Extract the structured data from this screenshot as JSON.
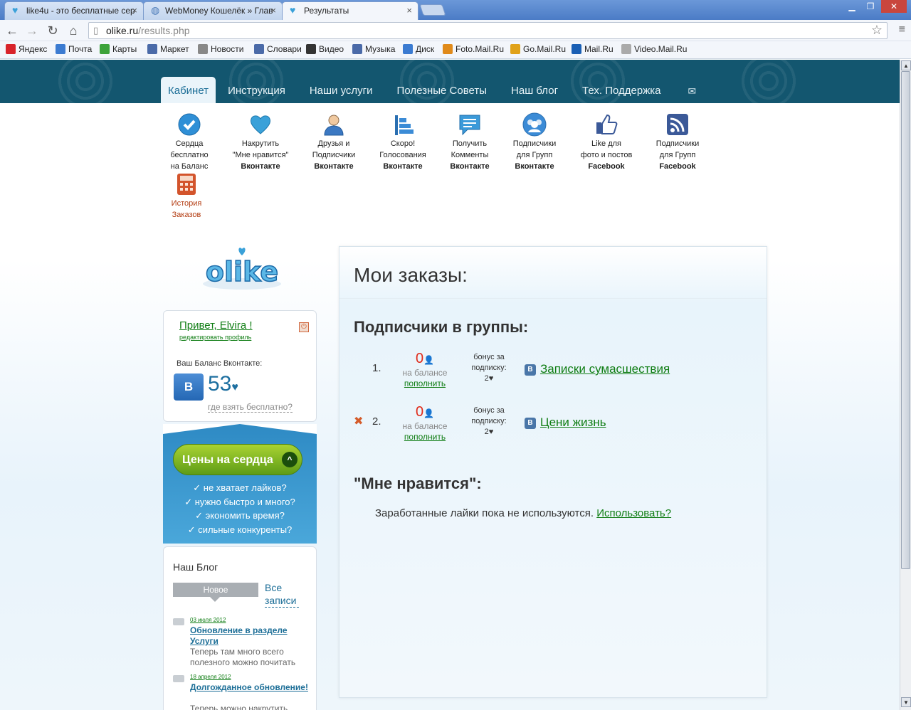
{
  "browser": {
    "tabs": [
      {
        "label": "like4u - это бесплатные сер"
      },
      {
        "label": "WebMoney Кошелёк » Глав"
      },
      {
        "label": "Результаты"
      }
    ],
    "url_host": "olike.ru",
    "url_path": "/results.php",
    "bookmarks": [
      {
        "label": "Яндекс",
        "icon_color": "#d8232a"
      },
      {
        "label": "Почта",
        "icon_color": "#3b7bd1"
      },
      {
        "label": "Карты",
        "icon_color": "#3da33a"
      },
      {
        "label": "Маркет",
        "icon_color": "#4a6aa8"
      },
      {
        "label": "Новости",
        "icon_color": "#888888"
      },
      {
        "label": "Словари",
        "icon_color": "#4a6aa8"
      },
      {
        "label": "Видео",
        "icon_color": "#333333"
      },
      {
        "label": "Музыка",
        "icon_color": "#4a6aa8"
      },
      {
        "label": "Диск",
        "icon_color": "#3b7bd1"
      },
      {
        "label": "Foto.Mail.Ru",
        "icon_color": "#e08a1a"
      },
      {
        "label": "Go.Mail.Ru",
        "icon_color": "#e0a21a"
      },
      {
        "label": "Mail.Ru",
        "icon_color": "#1a5fb4"
      },
      {
        "label": "Video.Mail.Ru",
        "icon_color": "#aaaaaa"
      }
    ]
  },
  "nav": {
    "items": [
      "Кабинет",
      "Инструкция",
      "Наши услуги",
      "Полезные Советы",
      "Наш блог",
      "Тех. Поддержка"
    ],
    "active": "Кабинет"
  },
  "services": [
    {
      "l1": "Сердца",
      "l2": "бесплатно",
      "l3": "на Баланс",
      "icon": "check-icon"
    },
    {
      "l1": "Накрутить",
      "l2": "\"Мне нравится\"",
      "l3": "Вконтакте",
      "icon": "heart-icon"
    },
    {
      "l1": "Друзья и",
      "l2": "Подписчики",
      "l3": "Вконтакте",
      "icon": "user-icon"
    },
    {
      "l1": "Скоро!",
      "l2": "Голосования",
      "l3": "Вконтакте",
      "icon": "poll-icon"
    },
    {
      "l1": "Получить",
      "l2": "Комменты",
      "l3": "Вконтакте",
      "icon": "comment-icon"
    },
    {
      "l1": "Подписчики",
      "l2": "для Групп",
      "l3": "Вконтакте",
      "icon": "group-icon"
    },
    {
      "l1": "Like для",
      "l2": "фото и постов",
      "l3": "Facebook",
      "icon": "thumbs-up-icon"
    },
    {
      "l1": "Подписчики",
      "l2": "для Групп",
      "l3": "Facebook",
      "icon": "rss-icon"
    },
    {
      "l1": "История",
      "l2": "Заказов",
      "l3": "",
      "icon": "calculator-icon"
    }
  ],
  "logo_text": "olike",
  "profile": {
    "greeting": "Привет, Elvira !",
    "edit_link": "редактировать профиль",
    "balance_label": "Ваш Баланс Вконтакте:",
    "balance": "53",
    "heart": "♥",
    "free_link": "где взять бесплатно?"
  },
  "prices": {
    "button": "Цены на сердца",
    "bullets": [
      "✓ не хватает лайков?",
      "✓ нужно быстро и много?",
      "✓ экономить время?",
      "✓ сильные конкуренты?"
    ]
  },
  "blog": {
    "title": "Наш Блог",
    "tab_new": "Новое",
    "all_link": "Все записи",
    "posts": [
      {
        "date": "03 июля 2012",
        "title": "Обновление в разделе Услуги",
        "text": "Теперь там много всего полезного можно почитать"
      },
      {
        "date": "18 апреля 2012",
        "title": "Долгожданное обновление!",
        "text": "Теперь можно накрутить"
      }
    ]
  },
  "orders": {
    "title": "Мои заказы:",
    "section1": "Подписчики в группы:",
    "items": [
      {
        "num": "1.",
        "balance": "0",
        "balance_label": "на балансе",
        "refill": "пополнить",
        "bonus1": "бонус за",
        "bonus2": "подписку:",
        "bonus3": "2♥",
        "group": "Записки сумасшествия",
        "deletable": false
      },
      {
        "num": "2.",
        "balance": "0",
        "balance_label": "на балансе",
        "refill": "пополнить",
        "bonus1": "бонус за",
        "bonus2": "подписку:",
        "bonus3": "2♥",
        "group": "Цени жизнь",
        "deletable": true
      }
    ],
    "section2": "\"Мне нравится\":",
    "likes_note": "Заработанные лайки пока не используются.",
    "likes_link": "Использовать?"
  }
}
